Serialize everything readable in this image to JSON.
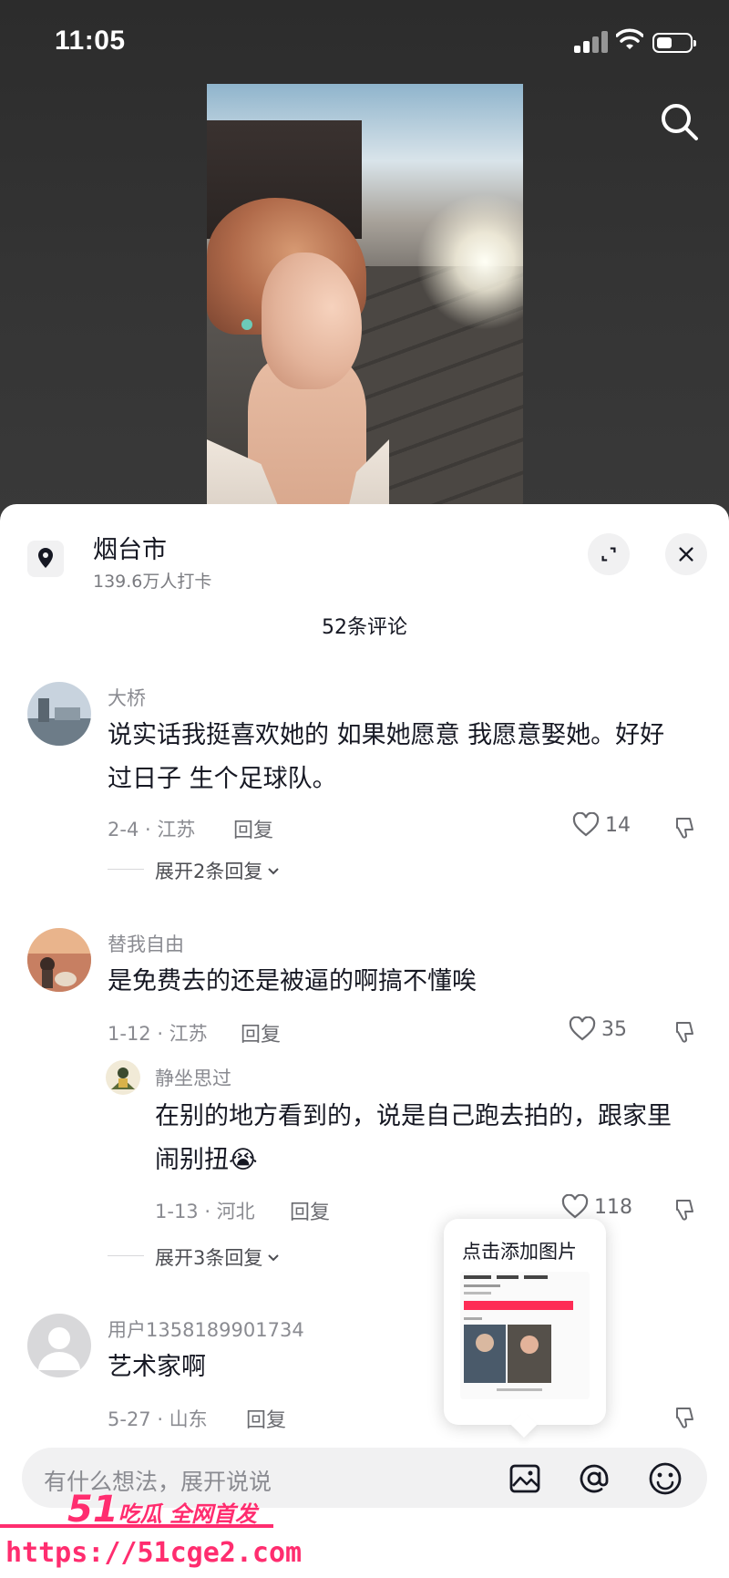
{
  "status_bar": {
    "time": "11:05"
  },
  "location": {
    "title": "烟台市",
    "subtitle": "139.6万人打卡"
  },
  "comments_header": "52条评论",
  "comments": [
    {
      "username": "大桥",
      "text_lines": [
        "说实话我挺喜欢她的 如果她愿意 我愿意娶她。好好",
        "过日子 生个足球队。"
      ],
      "date_location": "2-4 · 江苏",
      "reply_label": "回复",
      "likes": "14",
      "expand_label": "展开2条回复"
    },
    {
      "username": "替我自由",
      "text_lines": [
        "是免费去的还是被逼的啊搞不懂唉"
      ],
      "date_location": "1-12 · 江苏",
      "reply_label": "回复",
      "likes": "35"
    },
    {
      "username": "静坐思过",
      "text_lines": [
        "在别的地方看到的，说是自己跑去拍的，跟家里",
        "闹别扭"
      ],
      "emoji": "😭",
      "date_location": "1-13 · 河北",
      "reply_label": "回复",
      "likes": "118",
      "expand_label": "展开3条回复"
    },
    {
      "username": "用户1358189901734",
      "text_lines": [
        "艺术家啊"
      ],
      "date_location": "5-27 · 山东",
      "reply_label": "回复"
    }
  ],
  "popup": {
    "title": "点击添加图片"
  },
  "input": {
    "placeholder": "有什么想法，展开说说"
  },
  "watermark": {
    "brand_num": "51",
    "brand_text": "吃瓜 全网首发",
    "url": "https://51cge2.com"
  },
  "colors": {
    "accent": "#ff2d6f",
    "sheet_bg": "#ffffff",
    "muted_text": "#8a8b91"
  },
  "icons": [
    "search-icon",
    "location-pin-icon",
    "expand-icon",
    "close-icon",
    "heart-icon",
    "dislike-icon",
    "chevron-down-icon",
    "image-icon",
    "at-icon",
    "emoji-icon"
  ]
}
